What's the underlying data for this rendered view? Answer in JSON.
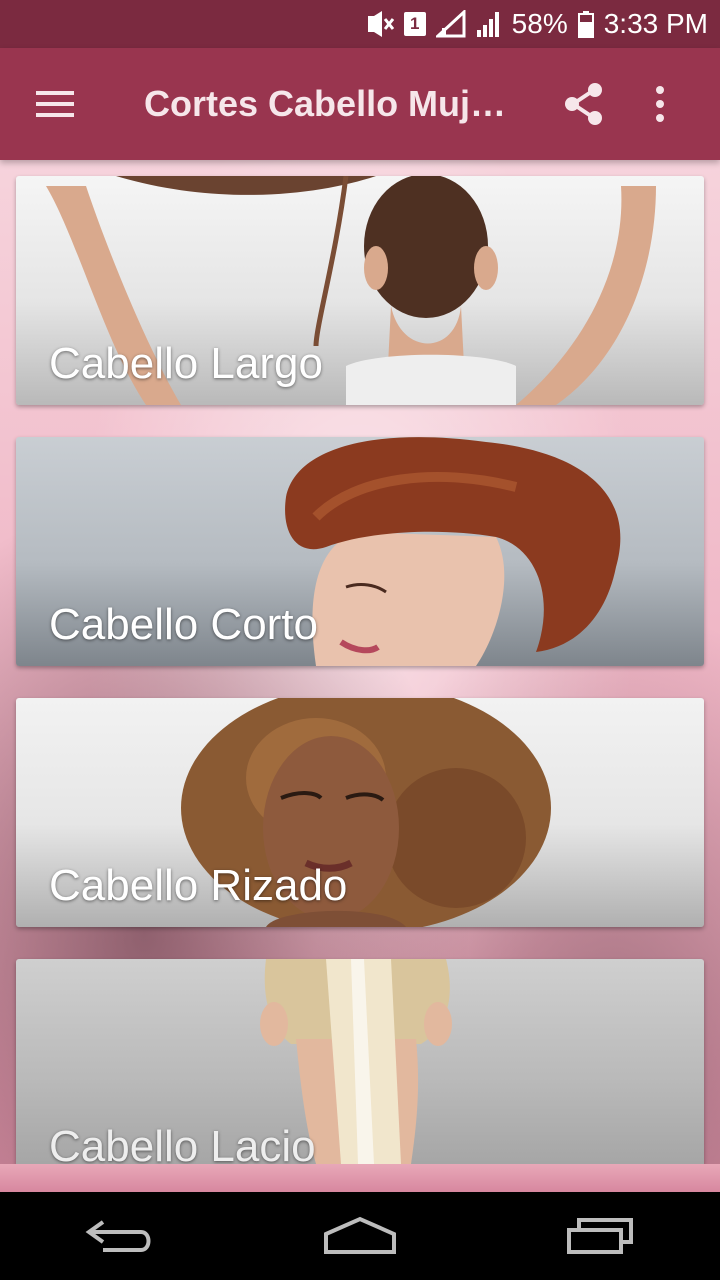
{
  "status_bar": {
    "battery_percent": "58%",
    "time": "3:33 PM",
    "sim_slot": "1",
    "icons": [
      "mute-vibrate-icon",
      "sim-badge-icon",
      "signal-empty-icon",
      "signal-icon",
      "battery-icon"
    ]
  },
  "app_bar": {
    "title": "Cortes Cabello Muj…",
    "icons": [
      "hamburger-menu-icon",
      "share-icon",
      "more-vert-icon"
    ],
    "color": "#99354f"
  },
  "categories": [
    {
      "label": "Cabello Largo"
    },
    {
      "label": "Cabello Corto"
    },
    {
      "label": "Cabello Rizado"
    },
    {
      "label": "Cabello Lacio"
    }
  ],
  "nav_bar": {
    "icons": [
      "back-icon",
      "home-icon",
      "recents-icon"
    ]
  },
  "colors": {
    "status_bar": "#7b2a40",
    "app_bar": "#99354f",
    "background": "#f3c6d2"
  }
}
